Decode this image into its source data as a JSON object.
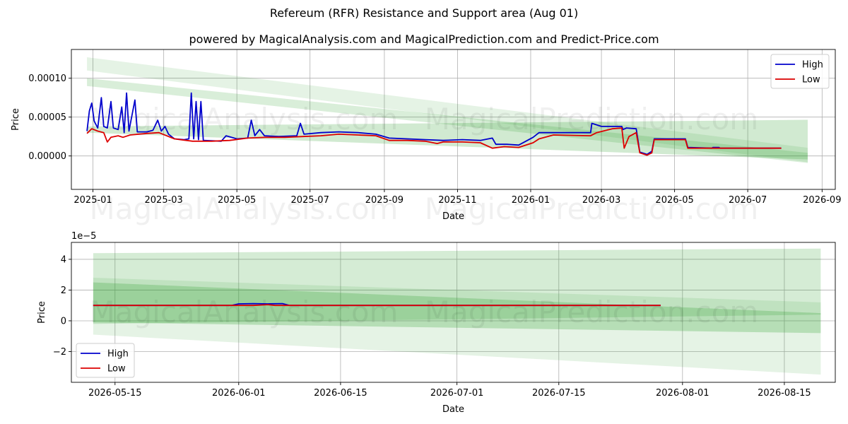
{
  "title": "Refereum (RFR) Resistance and Support area (Aug 01)",
  "subtitle": "powered by MagicalAnalysis.com and MagicalPrediction.com and Predict-Price.com",
  "watermarks": [
    "MagicalAnalysis.com",
    "MagicalPrediction.com"
  ],
  "colors": {
    "high": "#0000cc",
    "low": "#dd0000",
    "band": "#2ca02c"
  },
  "chart_data": [
    {
      "type": "line",
      "xlabel": "Date",
      "ylabel": "Price",
      "xlim": [
        "2024-12-14",
        "2026-09-12"
      ],
      "ylim": [
        -4.3e-05,
        0.000137
      ],
      "grid": true,
      "legend": "top-right",
      "x_ticks": [
        "2025-01",
        "2025-03",
        "2025-05",
        "2025-07",
        "2025-09",
        "2025-11",
        "2026-01",
        "2026-03",
        "2026-05",
        "2026-07",
        "2026-09"
      ],
      "y_ticks": [
        0.0,
        5e-05,
        0.0001
      ],
      "y_tick_labels": [
        "0.00000",
        "0.00005",
        "0.00010"
      ],
      "bands": [
        {
          "x": [
            "2024-12-27",
            "2026-08-20"
          ],
          "upper": [
            0.000127,
            1.05e-05
          ],
          "lower": [
            0.00011,
            -8e-06
          ],
          "opacity": 0.12
        },
        {
          "x": [
            "2024-12-27",
            "2026-08-20"
          ],
          "upper": [
            3.8e-05,
            4.65e-05
          ],
          "lower": [
            3e-05,
            -4.5e-06
          ],
          "opacity": 0.22
        },
        {
          "x": [
            "2024-12-27",
            "2026-08-20"
          ],
          "upper": [
            0.0001,
            4e-06
          ],
          "lower": [
            9e-05,
            -9e-06
          ],
          "opacity": 0.18
        }
      ],
      "series": [
        {
          "name": "High",
          "color": "#0000cc",
          "points": [
            [
              "2024-12-27",
              3.2e-05
            ],
            [
              "2024-12-29",
              5.8e-05
            ],
            [
              "2024-12-31",
              6.8e-05
            ],
            [
              "2025-01-02",
              4.5e-05
            ],
            [
              "2025-01-05",
              3.6e-05
            ],
            [
              "2025-01-08",
              7.5e-05
            ],
            [
              "2025-01-10",
              3.8e-05
            ],
            [
              "2025-01-13",
              3.6e-05
            ],
            [
              "2025-01-16",
              7e-05
            ],
            [
              "2025-01-18",
              3.6e-05
            ],
            [
              "2025-01-22",
              3.4e-05
            ],
            [
              "2025-01-25",
              6.3e-05
            ],
            [
              "2025-01-27",
              3e-05
            ],
            [
              "2025-01-29",
              8.1e-05
            ],
            [
              "2025-01-31",
              3.2e-05
            ],
            [
              "2025-02-05",
              7.2e-05
            ],
            [
              "2025-02-07",
              3.1e-05
            ],
            [
              "2025-02-15",
              3.1e-05
            ],
            [
              "2025-02-20",
              3.3e-05
            ],
            [
              "2025-02-24",
              4.6e-05
            ],
            [
              "2025-02-27",
              3.2e-05
            ],
            [
              "2025-03-02",
              3.8e-05
            ],
            [
              "2025-03-05",
              2.8e-05
            ],
            [
              "2025-03-10",
              2.2e-05
            ],
            [
              "2025-03-18",
              2.1e-05
            ],
            [
              "2025-03-22",
              2.2e-05
            ],
            [
              "2025-03-24",
              8.1e-05
            ],
            [
              "2025-03-26",
              2.2e-05
            ],
            [
              "2025-03-28",
              7e-05
            ],
            [
              "2025-03-30",
              2.1e-05
            ],
            [
              "2025-04-01",
              7e-05
            ],
            [
              "2025-04-03",
              2e-05
            ],
            [
              "2025-04-18",
              1.9e-05
            ],
            [
              "2025-04-22",
              2.6e-05
            ],
            [
              "2025-05-01",
              2.2e-05
            ],
            [
              "2025-05-10",
              2.3e-05
            ],
            [
              "2025-05-13",
              4.6e-05
            ],
            [
              "2025-05-16",
              2.6e-05
            ],
            [
              "2025-05-20",
              3.4e-05
            ],
            [
              "2025-05-24",
              2.6e-05
            ],
            [
              "2025-06-05",
              2.5e-05
            ],
            [
              "2025-06-20",
              2.6e-05
            ],
            [
              "2025-06-23",
              4.2e-05
            ],
            [
              "2025-06-26",
              2.8e-05
            ],
            [
              "2025-07-10",
              3e-05
            ],
            [
              "2025-07-25",
              3.1e-05
            ],
            [
              "2025-08-10",
              3e-05
            ],
            [
              "2025-08-25",
              2.8e-05
            ],
            [
              "2025-09-05",
              2.3e-05
            ],
            [
              "2025-09-20",
              2.2e-05
            ],
            [
              "2025-10-05",
              2.1e-05
            ],
            [
              "2025-10-20",
              2e-05
            ],
            [
              "2025-11-05",
              2.1e-05
            ],
            [
              "2025-11-20",
              2e-05
            ],
            [
              "2025-11-30",
              2.3e-05
            ],
            [
              "2025-12-03",
              1.5e-05
            ],
            [
              "2025-12-12",
              1.5e-05
            ],
            [
              "2025-12-22",
              1.4e-05
            ],
            [
              "2026-01-03",
              2.4e-05
            ],
            [
              "2026-01-08",
              3e-05
            ],
            [
              "2026-02-10",
              3e-05
            ],
            [
              "2026-02-20",
              3e-05
            ],
            [
              "2026-02-21",
              4.2e-05
            ],
            [
              "2026-03-01",
              3.8e-05
            ],
            [
              "2026-03-18",
              3.8e-05
            ],
            [
              "2026-03-19",
              3.4e-05
            ],
            [
              "2026-03-22",
              3.6e-05
            ],
            [
              "2026-03-30",
              3.5e-05
            ],
            [
              "2026-04-02",
              5e-06
            ],
            [
              "2026-04-08",
              2e-06
            ],
            [
              "2026-04-12",
              6e-06
            ],
            [
              "2026-04-14",
              2.2e-05
            ],
            [
              "2026-05-10",
              2.2e-05
            ],
            [
              "2026-05-12",
              1.1e-05
            ],
            [
              "2026-06-01",
              1e-05
            ],
            [
              "2026-06-02",
              1.1e-05
            ],
            [
              "2026-06-07",
              1.1e-05
            ],
            [
              "2026-06-08",
              1e-05
            ],
            [
              "2026-07-29",
              1e-05
            ]
          ]
        },
        {
          "name": "Low",
          "color": "#dd0000",
          "points": [
            [
              "2024-12-27",
              2.9e-05
            ],
            [
              "2024-12-31",
              3.5e-05
            ],
            [
              "2025-01-05",
              3.2e-05
            ],
            [
              "2025-01-10",
              3e-05
            ],
            [
              "2025-01-13",
              1.8e-05
            ],
            [
              "2025-01-16",
              2.4e-05
            ],
            [
              "2025-01-22",
              2.6e-05
            ],
            [
              "2025-01-26",
              2.4e-05
            ],
            [
              "2025-02-01",
              2.7e-05
            ],
            [
              "2025-02-15",
              2.9e-05
            ],
            [
              "2025-02-25",
              3e-05
            ],
            [
              "2025-03-05",
              2.5e-05
            ],
            [
              "2025-03-10",
              2.2e-05
            ],
            [
              "2025-03-25",
              1.9e-05
            ],
            [
              "2025-04-10",
              1.9e-05
            ],
            [
              "2025-04-25",
              2e-05
            ],
            [
              "2025-05-10",
              2.3e-05
            ],
            [
              "2025-05-25",
              2.4e-05
            ],
            [
              "2025-06-10",
              2.4e-05
            ],
            [
              "2025-06-25",
              2.5e-05
            ],
            [
              "2025-07-10",
              2.6e-05
            ],
            [
              "2025-07-25",
              2.8e-05
            ],
            [
              "2025-08-10",
              2.7e-05
            ],
            [
              "2025-08-25",
              2.6e-05
            ],
            [
              "2025-09-05",
              2e-05
            ],
            [
              "2025-09-20",
              2e-05
            ],
            [
              "2025-10-05",
              1.9e-05
            ],
            [
              "2025-10-15",
              1.6e-05
            ],
            [
              "2025-10-20",
              1.8e-05
            ],
            [
              "2025-11-05",
              1.8e-05
            ],
            [
              "2025-11-20",
              1.7e-05
            ],
            [
              "2025-11-30",
              1e-05
            ],
            [
              "2025-12-10",
              1.2e-05
            ],
            [
              "2025-12-22",
              1.1e-05
            ],
            [
              "2026-01-03",
              1.7e-05
            ],
            [
              "2026-01-08",
              2.2e-05
            ],
            [
              "2026-01-20",
              2.7e-05
            ],
            [
              "2026-02-20",
              2.6e-05
            ],
            [
              "2026-02-25",
              3e-05
            ],
            [
              "2026-03-10",
              3.5e-05
            ],
            [
              "2026-03-18",
              3.6e-05
            ],
            [
              "2026-03-20",
              1e-05
            ],
            [
              "2026-03-24",
              2.5e-05
            ],
            [
              "2026-03-30",
              3e-05
            ],
            [
              "2026-04-02",
              4e-06
            ],
            [
              "2026-04-08",
              1e-06
            ],
            [
              "2026-04-12",
              4e-06
            ],
            [
              "2026-04-14",
              2.1e-05
            ],
            [
              "2026-05-10",
              2.1e-05
            ],
            [
              "2026-05-12",
              1e-05
            ],
            [
              "2026-07-29",
              1e-05
            ]
          ]
        }
      ]
    },
    {
      "type": "line",
      "xlabel": "Date",
      "ylabel": "Price",
      "y_multiplier": "1e−5",
      "xlim": [
        "2026-05-09",
        "2026-08-22"
      ],
      "ylim": [
        -4.0,
        5.1
      ],
      "grid": true,
      "legend": "bottom-left",
      "x_ticks": [
        "2026-05-15",
        "2026-06-01",
        "2026-06-15",
        "2026-07-01",
        "2026-07-15",
        "2026-08-01",
        "2026-08-15"
      ],
      "y_ticks": [
        -2,
        0,
        2,
        4
      ],
      "y_tick_labels": [
        "−2",
        "0",
        "2",
        "4"
      ],
      "bands": [
        {
          "x": [
            "2026-05-12",
            "2026-08-20"
          ],
          "upper": [
            4.4,
            4.7
          ],
          "lower": [
            -0.2,
            0.4
          ],
          "opacity": 0.2
        },
        {
          "x": [
            "2026-05-12",
            "2026-08-20"
          ],
          "upper": [
            2.8,
            1.2
          ],
          "lower": [
            -0.9,
            -3.5
          ],
          "opacity": 0.12
        },
        {
          "x": [
            "2026-05-12",
            "2026-08-20"
          ],
          "upper": [
            2.5,
            0.5
          ],
          "lower": [
            -0.1,
            -0.8
          ],
          "opacity": 0.25
        }
      ],
      "series": [
        {
          "name": "High",
          "color": "#0000cc",
          "points": [
            [
              "2026-05-12",
              1.0
            ],
            [
              "2026-05-31",
              1.0
            ],
            [
              "2026-06-01",
              1.1
            ],
            [
              "2026-06-03",
              1.12
            ],
            [
              "2026-06-05",
              1.1
            ],
            [
              "2026-06-07",
              1.12
            ],
            [
              "2026-06-08",
              1.0
            ],
            [
              "2026-07-29",
              1.0
            ]
          ]
        },
        {
          "name": "Low",
          "color": "#dd0000",
          "points": [
            [
              "2026-05-12",
              1.0
            ],
            [
              "2026-06-03",
              1.0
            ],
            [
              "2026-06-05",
              1.05
            ],
            [
              "2026-06-06",
              1.0
            ],
            [
              "2026-07-29",
              1.0
            ]
          ]
        }
      ]
    }
  ]
}
